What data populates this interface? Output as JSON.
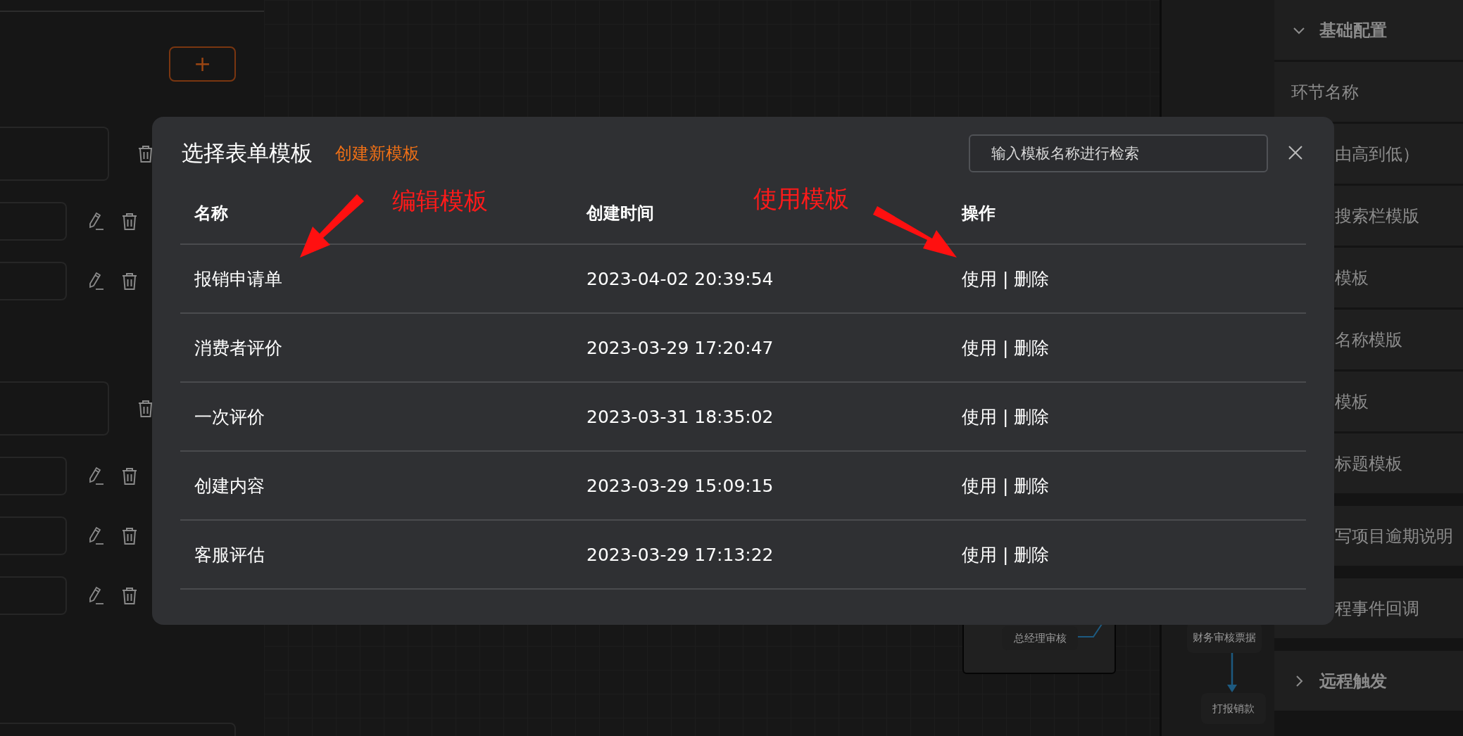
{
  "left_panel": {
    "add_button": {
      "label": "+"
    },
    "groups": [
      {
        "rows": [
          {
            "kind": "wide"
          },
          {
            "kind": "narrow"
          },
          {
            "kind": "narrow"
          }
        ]
      },
      {
        "rows": [
          {
            "kind": "wide"
          },
          {
            "kind": "narrow"
          },
          {
            "kind": "narrow"
          },
          {
            "kind": "narrow"
          }
        ]
      }
    ]
  },
  "canvas": {
    "nodes": [
      {
        "label": "总经理审核"
      },
      {
        "label": "财务审核票据"
      },
      {
        "label": "打报销款"
      }
    ]
  },
  "config_panel": {
    "groups": [
      {
        "items": [
          {
            "kind": "section",
            "label": "基础配置",
            "expanded": true
          },
          {
            "kind": "field",
            "label": "环节名称"
          },
          {
            "kind": "partial",
            "label": "由高到低）"
          },
          {
            "kind": "partial",
            "label": "搜索栏模版"
          },
          {
            "kind": "partial",
            "label": "模板"
          },
          {
            "kind": "partial",
            "label": "名称模版"
          },
          {
            "kind": "partial",
            "label": "模板"
          },
          {
            "kind": "partial",
            "label": "标题模板"
          }
        ]
      },
      {
        "items": [
          {
            "kind": "partial",
            "label": "写项目逾期说明"
          }
        ]
      },
      {
        "items": [
          {
            "kind": "partial",
            "label": "程事件回调"
          }
        ]
      },
      {
        "items": [
          {
            "kind": "section",
            "label": "远程触发",
            "expanded": false
          }
        ]
      }
    ]
  },
  "modal": {
    "title": "选择表单模板",
    "create_link": "创建新模板",
    "search": {
      "placeholder": "输入模板名称进行检索"
    },
    "table": {
      "columns": [
        "名称",
        "创建时间",
        "操作"
      ],
      "rows": [
        {
          "name": "报销申请单",
          "created": "2023-04-02 20:39:54",
          "actions": [
            "使用",
            "|",
            "删除"
          ]
        },
        {
          "name": "消费者评价",
          "created": "2023-03-29 17:20:47",
          "actions": [
            "使用",
            "|",
            "删除"
          ]
        },
        {
          "name": "一次评价",
          "created": "2023-03-31 18:35:02",
          "actions": [
            "使用",
            "|",
            "删除"
          ]
        },
        {
          "name": "创建内容",
          "created": "2023-03-29 15:09:15",
          "actions": [
            "使用",
            "|",
            "删除"
          ]
        },
        {
          "name": "客服评估",
          "created": "2023-03-29 17:13:22",
          "actions": [
            "使用",
            "|",
            "删除"
          ]
        }
      ]
    }
  },
  "annotations": [
    {
      "text": "编辑模板"
    },
    {
      "text": "使用模板"
    }
  ]
}
